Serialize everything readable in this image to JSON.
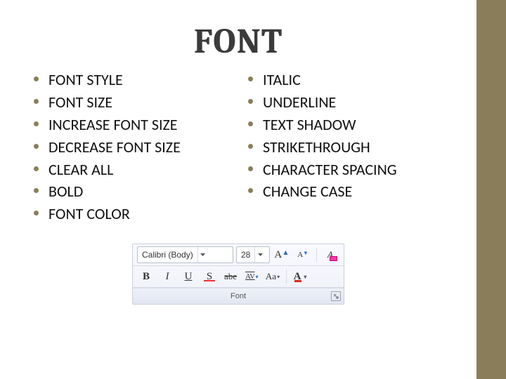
{
  "title": "FONT",
  "columns": {
    "left": [
      "FONT STYLE",
      "FONT SIZE",
      "INCREASE FONT SIZE",
      "DECREASE FONT SIZE",
      "CLEAR ALL",
      "BOLD",
      "FONT COLOR"
    ],
    "right": [
      "ITALIC",
      "UNDERLINE",
      "TEXT SHADOW",
      "STRIKETHROUGH",
      "CHARACTER SPACING",
      "CHANGE CASE"
    ]
  },
  "ribbon": {
    "font_name": "Calibri (Body)",
    "font_size": "28",
    "group_label": "Font",
    "buttons": {
      "grow": "A",
      "grow_sup": "▲",
      "shrink": "A",
      "shrink_sup": "▼",
      "clear": "A",
      "bold": "B",
      "italic": "I",
      "underline": "U",
      "shadow": "S",
      "strike": "abe",
      "spacing": "AV",
      "case": "Aa"
    }
  }
}
